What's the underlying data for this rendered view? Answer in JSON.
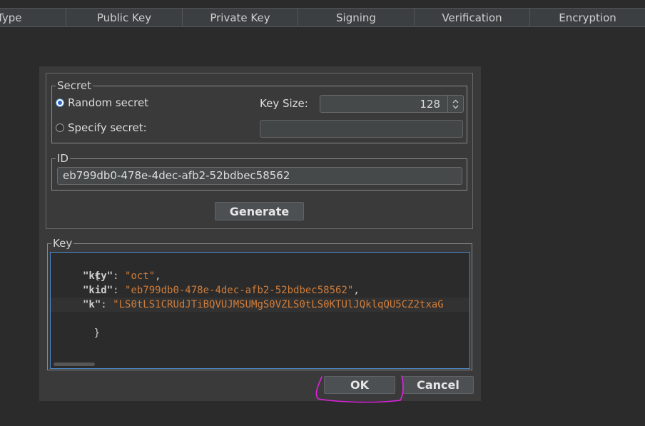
{
  "table": {
    "columns": [
      {
        "label": "Type",
        "width": 93
      },
      {
        "label": "Public Key",
        "width": 163
      },
      {
        "label": "Private Key",
        "width": 162
      },
      {
        "label": "Signing",
        "width": 163
      },
      {
        "label": "Verification",
        "width": 162
      },
      {
        "label": "Encryption",
        "width": 161
      }
    ]
  },
  "secret_group": {
    "title": "Secret",
    "random_label": "Random secret",
    "specify_label": "Specify secret:",
    "key_size_label": "Key Size:",
    "key_size_value": "128",
    "specify_value": ""
  },
  "id_group": {
    "title": "ID",
    "value": "eb799db0-478e-4dec-afb2-52bdbec58562"
  },
  "generate_label": "Generate",
  "key_group": {
    "title": "Key",
    "json": {
      "open": "{",
      "kty_key": "\"kty\"",
      "kty_value": "\"oct\"",
      "kid_key": "\"kid\"",
      "kid_value": "\"eb799db0-478e-4dec-afb2-52bdbec58562\"",
      "k_key": "\"k\"",
      "k_value": "\"LS0tLS1CRUdJTiBQVUJMSUMgS0VZLS0tLS0KTUlJQklqQU5CZ2txaG",
      "close": "}"
    }
  },
  "buttons": {
    "ok": "OK",
    "cancel": "Cancel"
  },
  "colors": {
    "annotation": "#e020e0",
    "accent": "#4a88c7",
    "string": "#d17d3a"
  }
}
